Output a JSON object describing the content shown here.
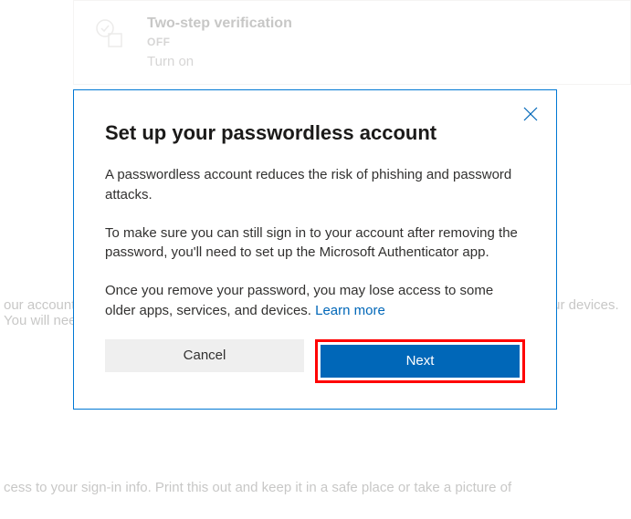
{
  "background": {
    "card": {
      "title": "Two-step verification",
      "status": "OFF",
      "link": "Turn on"
    },
    "text1": "our account more secure by requiring your password along with a verification code from your devices. You will need to verify your identity. We can send a code to your phone or email.",
    "text2": "cess to your sign-in info. Print this out and keep it in a safe place or take a picture of"
  },
  "modal": {
    "title": "Set up your passwordless account",
    "p1": "A passwordless account reduces the risk of phishing and password attacks.",
    "p2": "To make sure you can still sign in to your account after removing the password, you'll need to set up the Microsoft Authenticator app.",
    "p3_pre": "Once you remove your password, you may lose access to some older apps, services, and devices. ",
    "learn_more": "Learn more",
    "cancel": "Cancel",
    "next": "Next"
  }
}
